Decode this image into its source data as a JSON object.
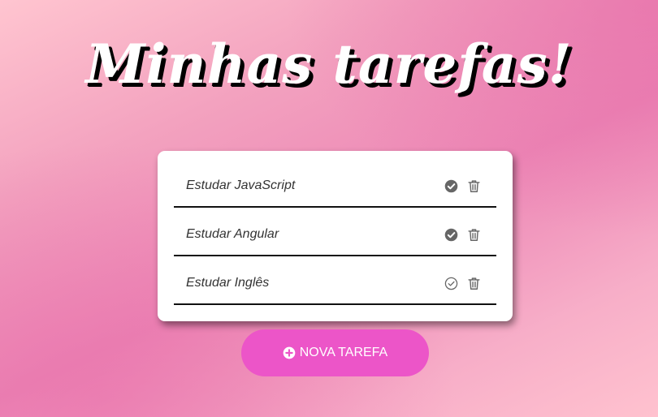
{
  "title": "Minhas tarefas!",
  "tasks": [
    {
      "text": "Estudar JavaScript",
      "done": true
    },
    {
      "text": "Estudar Angular",
      "done": true
    },
    {
      "text": "Estudar Inglês",
      "done": false
    }
  ],
  "icons": {
    "check_done": "check-circle-filled-icon",
    "check_pending": "check-circle-outline-icon",
    "delete": "trash-icon",
    "add": "plus-circle-icon"
  },
  "add_button": {
    "label": "NOVA TAREFA"
  },
  "colors": {
    "button": "#ec55c8",
    "icon": "#666666",
    "text": "#333333",
    "divider": "#111111"
  }
}
